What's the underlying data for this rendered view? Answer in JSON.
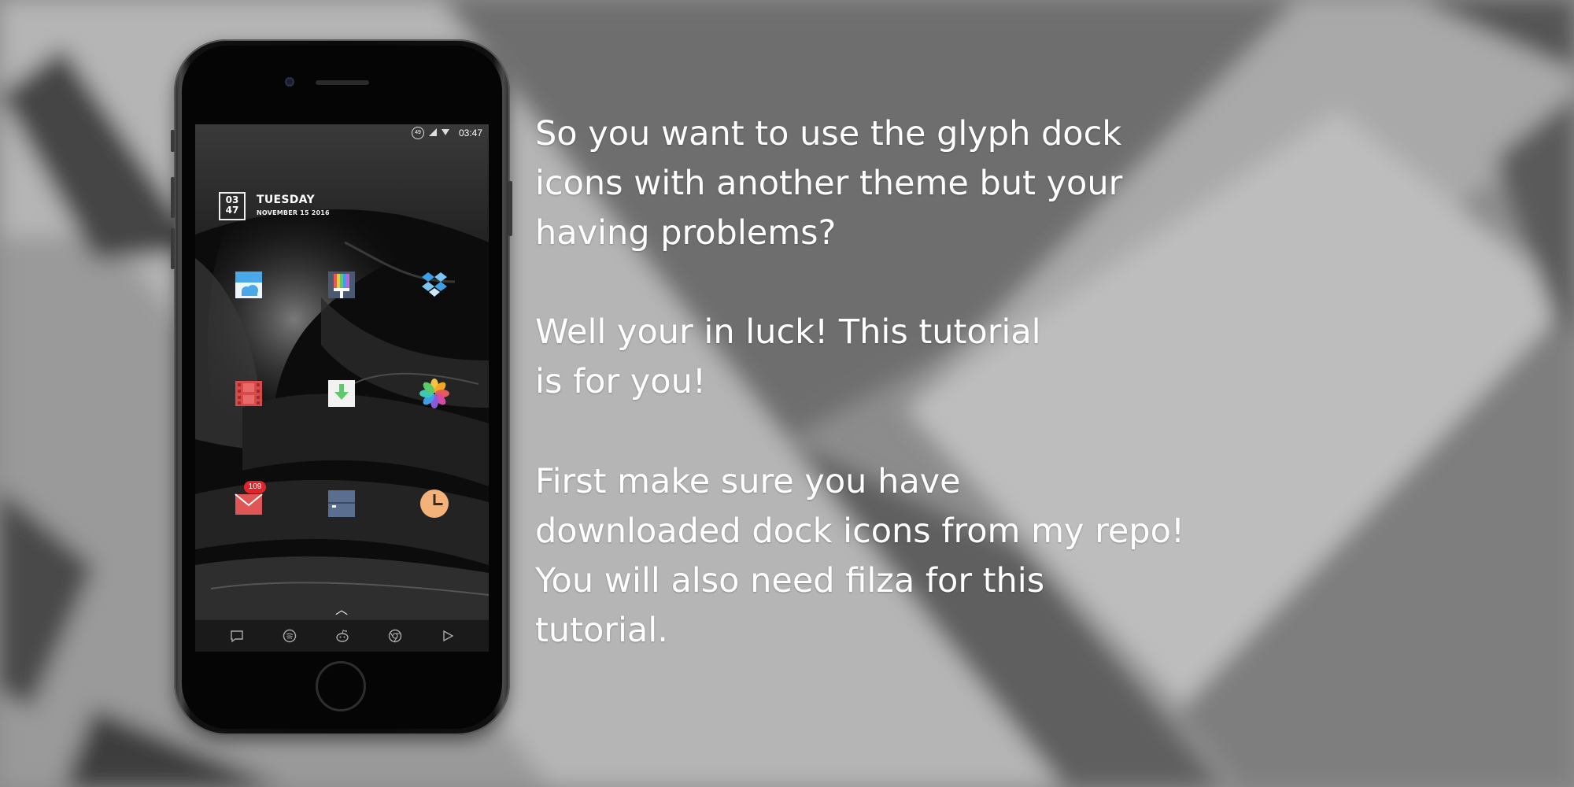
{
  "phone": {
    "status": {
      "battery": "49",
      "time": "03:47"
    },
    "widget": {
      "hour": "03",
      "minute": "47",
      "day": "TUESDAY",
      "date": "NOVEMBER 15 2016"
    },
    "apps": [
      {
        "name": "weather-icon",
        "color": "#4aa7e8"
      },
      {
        "name": "paint-icon",
        "color": "#4a5870"
      },
      {
        "name": "dropbox-icon",
        "color": "#3ca0e8"
      },
      {
        "name": "video-icon",
        "color": "#d84a4a"
      },
      {
        "name": "download-icon",
        "color": "#f2f2f2"
      },
      {
        "name": "photos-icon",
        "color": "#f5a623"
      },
      {
        "name": "mail-icon",
        "color": "#e05555"
      },
      {
        "name": "finder-icon",
        "color": "#5a6f8f"
      },
      {
        "name": "clock-icon",
        "color": "#f3b27a"
      }
    ],
    "mail_badge": "109",
    "dock": [
      "message-icon",
      "spotify-icon",
      "reddit-icon",
      "chrome-icon",
      "play-icon"
    ]
  },
  "text": {
    "paragraph1": "So you want to use the glyph dock\nicons with another theme but your\nhaving problems?",
    "paragraph2": "Well your in luck! This tutorial\nis for you!",
    "paragraph3": "First make sure you have\ndownloaded dock icons from my repo!\nYou will also need filza for this\ntutorial."
  }
}
